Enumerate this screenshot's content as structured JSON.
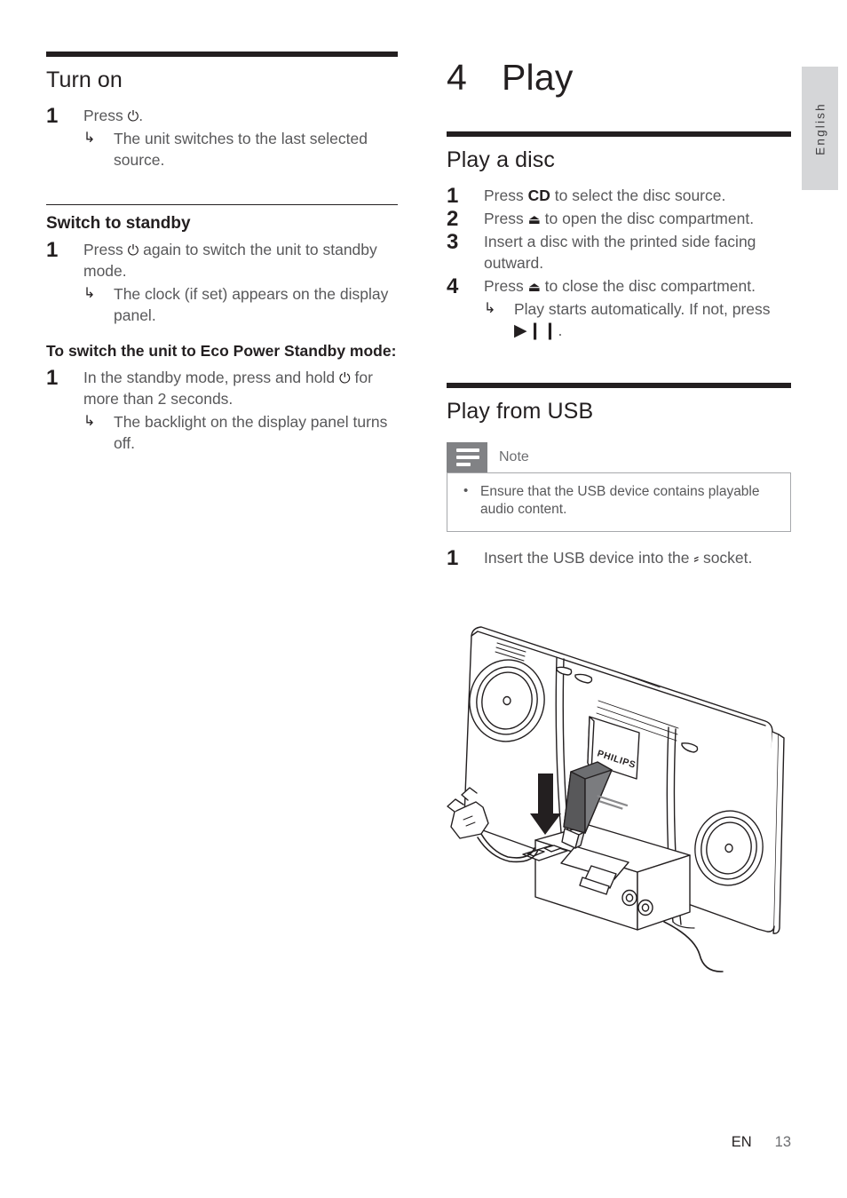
{
  "document": {
    "language_tab": "English",
    "footer": {
      "language_code": "EN",
      "page_number": "13"
    }
  },
  "left_column": {
    "heading": "Turn on",
    "turn_on_steps": [
      {
        "number": "1",
        "text_before": "Press",
        "icon": "power-icon",
        "icon_glyph": "⏻",
        "text_after": ".",
        "results": [
          {
            "arrow": "↳",
            "text": "The unit switches to the last selected source."
          }
        ]
      }
    ],
    "standby": {
      "heading": "Switch to standby",
      "steps": [
        {
          "number": "1",
          "text_before": "Press",
          "icon": "power-icon",
          "icon_glyph": "⏻",
          "text_after": "again to switch the unit to standby mode.",
          "results": [
            {
              "arrow": "↳",
              "text": "The clock (if set) appears on the display panel."
            }
          ]
        }
      ]
    },
    "eco_power": {
      "lead": "To switch the unit to Eco Power Standby mode:",
      "steps": [
        {
          "number": "1",
          "text_before": "In the standby mode, press and hold",
          "icon": "power-icon",
          "icon_glyph": "⏻",
          "text_after": "for more than 2 seconds.",
          "results": [
            {
              "arrow": "↳",
              "text": "The backlight on the display panel turns off."
            }
          ]
        }
      ]
    }
  },
  "right_column": {
    "chapter": {
      "number": "4",
      "title": "Play"
    },
    "play_a_disc": {
      "heading": "Play a disc",
      "steps": [
        {
          "number": "1",
          "text_before": "Press",
          "bold_token": "CD",
          "text_after": "to select the disc source."
        },
        {
          "number": "2",
          "text_before": "Press",
          "icon": "eject-icon",
          "icon_glyph": "⏏",
          "text_after": "to open the disc compartment."
        },
        {
          "number": "3",
          "text_before": "Insert a disc with the printed side facing outward.",
          "text_after": ""
        },
        {
          "number": "4",
          "text_before": "Press",
          "icon": "eject-icon",
          "icon_glyph": "⏏",
          "text_after": "to close the disc compartment.",
          "results": [
            {
              "arrow": "↳",
              "text": "Play starts automatically. If not, press",
              "icon": "play-pause-icon",
              "icon_glyph": "▶❙❙",
              "text_after": "."
            }
          ]
        }
      ]
    },
    "play_from_usb": {
      "heading": "Play from USB",
      "note": {
        "icon": "note-icon",
        "title": "Note",
        "items": [
          {
            "bullet": "•",
            "text": "Ensure that the USB device contains playable audio content."
          }
        ]
      },
      "steps": [
        {
          "number": "1",
          "text_before": "Insert the USB device into the",
          "icon": "usb-icon",
          "icon_glyph": "⸗",
          "text_after": "socket."
        }
      ],
      "illustration": {
        "name": "philips-micro-hifi-usb-insertion-diagram",
        "brand_label": "PHILIPS",
        "elements": [
          "rear-view-audio-system",
          "left-speaker-driver",
          "right-speaker-driver",
          "usb-flash-drive",
          "insertion-arrow",
          "power-plug",
          "power-cable",
          "connector-base"
        ]
      }
    }
  },
  "colors": {
    "ink": "#231f20",
    "body_text": "#58585a",
    "note_icon_bg": "#818285",
    "note_border": "#a7a9ac",
    "tab_bg": "#d5d6d8",
    "usb_drive": "#6d6e71"
  }
}
